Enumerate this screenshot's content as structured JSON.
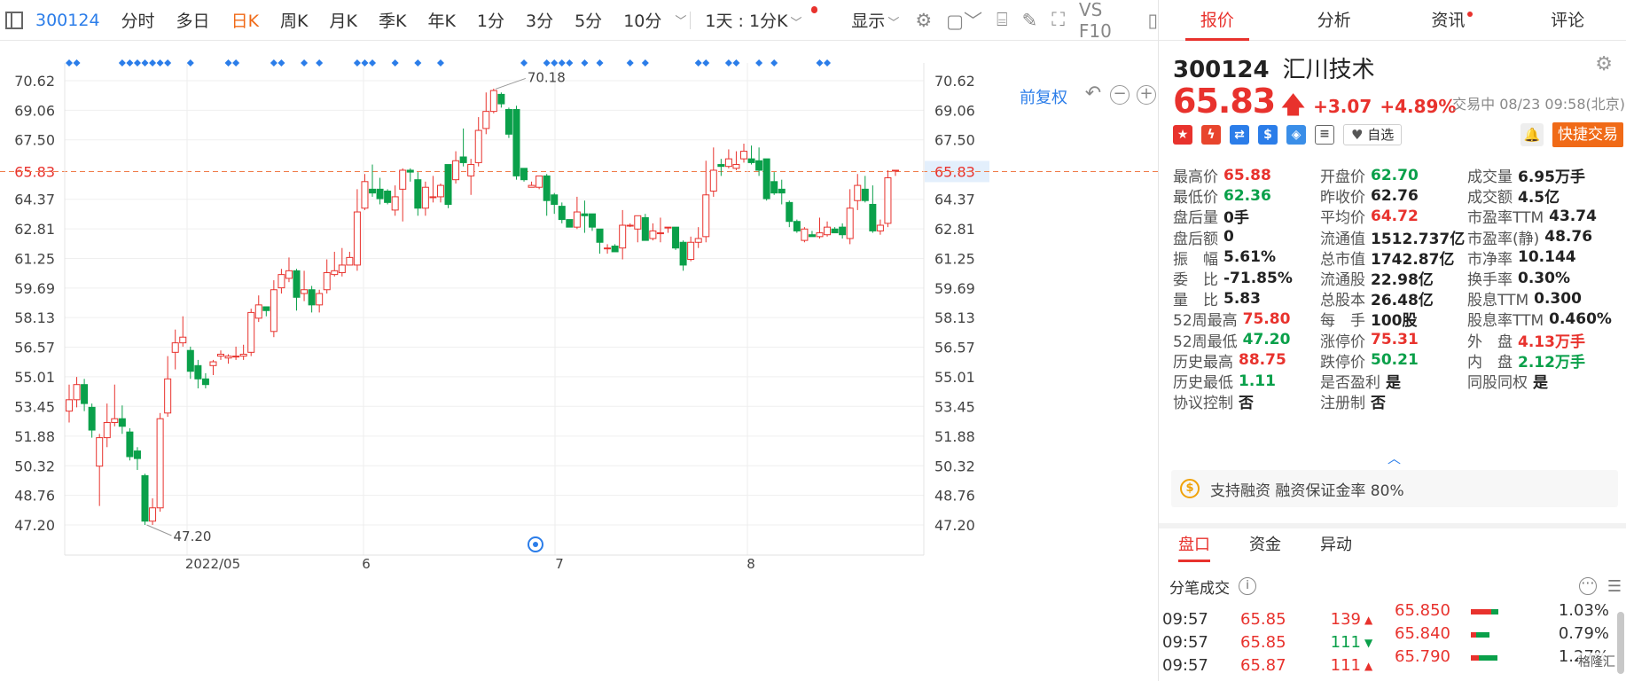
{
  "toolbar": {
    "code": "300124",
    "periods": [
      "分时",
      "多日",
      "日K",
      "周K",
      "月K",
      "季K",
      "年K",
      "1分",
      "3分",
      "5分",
      "10分"
    ],
    "active_period": "日K",
    "interval_select": "1天 : 1分K",
    "display_label": "显示",
    "f10_label": "VS F10"
  },
  "chart": {
    "fq_label": "前复权",
    "y_ticks": [
      "70.62",
      "69.06",
      "67.50",
      "65.83",
      "64.37",
      "62.81",
      "61.25",
      "59.69",
      "58.13",
      "56.57",
      "55.01",
      "53.45",
      "51.88",
      "50.32",
      "48.76",
      "47.20"
    ],
    "current_price_label": "65.83",
    "x_labels": [
      "2022/05",
      "6",
      "7",
      "8"
    ],
    "max_label": "70.18",
    "min_label": "47.20",
    "colors": {
      "up": "#e8322d",
      "down": "#0aa04a",
      "marker": "#2b7de9",
      "price_line": "#f07b4a"
    }
  },
  "chart_data": {
    "type": "candlestick",
    "ylim": [
      47.2,
      70.62
    ],
    "current_price": 65.83,
    "max": 70.18,
    "min": 47.2,
    "candles": [
      [
        53.2,
        53.8,
        54.6,
        52.6
      ],
      [
        53.8,
        54.6,
        55.0,
        53.4
      ],
      [
        54.6,
        53.6,
        54.9,
        53.2
      ],
      [
        53.4,
        52.2,
        53.6,
        51.8
      ],
      [
        50.3,
        51.8,
        52.0,
        48.2
      ],
      [
        51.8,
        52.6,
        53.6,
        51.3
      ],
      [
        52.6,
        52.8,
        54.6,
        52.4
      ],
      [
        52.8,
        52.4,
        53.5,
        52.0
      ],
      [
        52.1,
        50.8,
        52.3,
        50.6
      ],
      [
        51.1,
        50.7,
        51.3,
        50.1
      ],
      [
        49.8,
        47.4,
        49.9,
        47.2
      ],
      [
        47.4,
        48.1,
        48.6,
        47.2
      ],
      [
        48.1,
        52.8,
        53.1,
        47.9
      ],
      [
        53.1,
        54.9,
        56.1,
        52.9
      ],
      [
        56.3,
        56.8,
        57.5,
        55.4
      ],
      [
        56.8,
        57.1,
        58.2,
        56.6
      ],
      [
        56.4,
        55.3,
        56.6,
        54.9
      ],
      [
        55.6,
        54.9,
        55.9,
        54.4
      ],
      [
        54.9,
        54.6,
        55.2,
        54.4
      ],
      [
        55.6,
        55.8,
        55.9,
        55.1
      ],
      [
        56.1,
        56.2,
        56.4,
        55.9
      ],
      [
        56.0,
        56.1,
        56.2,
        55.7
      ],
      [
        56.1,
        56.1,
        56.6,
        55.9
      ],
      [
        56.1,
        56.2,
        56.7,
        55.9
      ],
      [
        56.3,
        58.4,
        58.6,
        56.1
      ],
      [
        58.1,
        58.8,
        59.3,
        57.9
      ],
      [
        58.7,
        58.5,
        58.6,
        58.2
      ],
      [
        57.4,
        59.6,
        60.1,
        57.1
      ],
      [
        59.7,
        60.4,
        60.7,
        59.4
      ],
      [
        60.2,
        60.6,
        61.3,
        60.0
      ],
      [
        60.6,
        59.2,
        60.7,
        58.5
      ],
      [
        59.4,
        59.6,
        60.6,
        59.0
      ],
      [
        59.6,
        58.8,
        59.8,
        58.4
      ],
      [
        58.8,
        59.4,
        59.6,
        58.4
      ],
      [
        59.6,
        60.5,
        61.2,
        59.4
      ],
      [
        60.4,
        60.6,
        61.6,
        60.3
      ],
      [
        60.5,
        60.9,
        61.8,
        60.3
      ],
      [
        60.9,
        61.3,
        61.6,
        60.9
      ],
      [
        60.9,
        63.7,
        64.9,
        60.6
      ],
      [
        63.9,
        65.3,
        65.7,
        63.8
      ],
      [
        64.9,
        64.7,
        66.2,
        64.5
      ],
      [
        64.9,
        64.4,
        65.5,
        64.1
      ],
      [
        64.8,
        64.2,
        64.9,
        64.1
      ],
      [
        63.8,
        64.5,
        65.1,
        63.5
      ],
      [
        64.9,
        65.9,
        66.0,
        63.2
      ],
      [
        65.9,
        65.8,
        66.0,
        65.3
      ],
      [
        65.4,
        63.9,
        65.8,
        63.5
      ],
      [
        63.9,
        65.0,
        65.3,
        63.5
      ],
      [
        64.5,
        64.5,
        65.6,
        64.2
      ],
      [
        64.5,
        65.1,
        65.2,
        64.2
      ],
      [
        66.2,
        64.1,
        66.2,
        63.9
      ],
      [
        65.4,
        66.4,
        66.9,
        65.2
      ],
      [
        66.6,
        66.3,
        68.1,
        66.1
      ],
      [
        65.6,
        66.2,
        66.5,
        64.6
      ],
      [
        66.3,
        68.0,
        68.7,
        66.1
      ],
      [
        68.1,
        69.0,
        70.0,
        67.8
      ],
      [
        69.0,
        70.1,
        70.2,
        68.9
      ],
      [
        69.9,
        69.4,
        70.0,
        69.2
      ],
      [
        69.1,
        67.8,
        69.2,
        67.6
      ],
      [
        69.1,
        65.6,
        69.3,
        65.4
      ],
      [
        66.0,
        65.4,
        65.7,
        65.3
      ],
      [
        65.0,
        65.1,
        65.3,
        65.0
      ],
      [
        65.0,
        65.6,
        65.6,
        64.9
      ],
      [
        65.6,
        64.3,
        65.7,
        63.5
      ],
      [
        64.6,
        64.1,
        64.7,
        63.6
      ],
      [
        64.0,
        63.3,
        64.2,
        63.1
      ],
      [
        63.3,
        62.9,
        63.2,
        62.9
      ],
      [
        62.9,
        63.7,
        64.5,
        62.8
      ],
      [
        63.6,
        63.5,
        64.3,
        62.6
      ],
      [
        63.6,
        62.9,
        63.6,
        62.7
      ],
      [
        62.8,
        62.1,
        62.7,
        61.5
      ],
      [
        61.8,
        61.8,
        62.0,
        61.5
      ],
      [
        61.9,
        61.6,
        62.0,
        61.6
      ],
      [
        61.8,
        63.0,
        63.8,
        61.2
      ],
      [
        63.0,
        63.0,
        63.1,
        62.9
      ],
      [
        62.8,
        63.5,
        63.5,
        62.1
      ],
      [
        63.4,
        62.2,
        63.6,
        62.2
      ],
      [
        62.3,
        62.7,
        63.1,
        62.2
      ],
      [
        62.6,
        62.6,
        63.4,
        62.1
      ],
      [
        62.9,
        62.9,
        62.9,
        62.6
      ],
      [
        62.9,
        61.8,
        62.1,
        61.7
      ],
      [
        62.1,
        60.9,
        62.2,
        60.6
      ],
      [
        61.2,
        62.1,
        62.4,
        61.1
      ],
      [
        62.1,
        62.3,
        62.9,
        61.8
      ],
      [
        62.4,
        64.6,
        66.4,
        62.1
      ],
      [
        64.8,
        65.9,
        67.1,
        64.5
      ],
      [
        66.2,
        66.1,
        66.5,
        65.6
      ],
      [
        66.1,
        66.5,
        67.0,
        66.0
      ],
      [
        66.0,
        66.2,
        66.9,
        65.9
      ],
      [
        66.5,
        66.9,
        67.3,
        66.3
      ],
      [
        66.5,
        66.3,
        67.2,
        66.2
      ],
      [
        66.4,
        65.9,
        67.1,
        65.6
      ],
      [
        66.5,
        64.4,
        66.2,
        64.3
      ],
      [
        65.3,
        64.7,
        65.8,
        64.6
      ],
      [
        64.9,
        64.7,
        65.4,
        64.1
      ],
      [
        64.2,
        63.2,
        64.3,
        62.9
      ],
      [
        63.2,
        62.7,
        63.3,
        62.6
      ],
      [
        62.2,
        62.8,
        62.9,
        62.1
      ],
      [
        62.5,
        62.4,
        62.7,
        62.4
      ],
      [
        62.4,
        62.6,
        63.4,
        62.3
      ],
      [
        62.5,
        62.9,
        63.2,
        62.4
      ],
      [
        62.8,
        62.6,
        62.9,
        62.6
      ],
      [
        62.9,
        62.5,
        63.1,
        62.3
      ],
      [
        62.3,
        63.9,
        64.9,
        62.0
      ],
      [
        64.3,
        65.1,
        65.7,
        63.8
      ],
      [
        64.9,
        64.3,
        65.6,
        64.2
      ],
      [
        64.1,
        62.7,
        65.1,
        62.6
      ],
      [
        62.7,
        63.0,
        63.3,
        62.5
      ],
      [
        63.1,
        65.5,
        65.9,
        62.9
      ],
      [
        65.9,
        65.9,
        65.9,
        65.6
      ]
    ],
    "marker_rows": [
      "◆ ◆",
      "◆ ◆ ◆ ◆ ◆ ◆ ◆",
      "◆ ◆"
    ],
    "x_labels": [
      "2022/05",
      "6",
      "7",
      "8"
    ]
  },
  "quote": {
    "tabs": [
      "报价",
      "分析",
      "资讯",
      "评论"
    ],
    "code": "300124",
    "name": "汇川技术",
    "price": "65.83",
    "change": "+3.07",
    "change_pct": "+4.89%",
    "status": "交易中 08/23 09:58(北京)",
    "watch_label": "自选",
    "quick_trade_label": "快捷交易",
    "col1": [
      {
        "k": "最高价",
        "v": "65.88",
        "c": "red"
      },
      {
        "k": "最低价",
        "v": "62.36",
        "c": "green"
      },
      {
        "k": "盘后量",
        "v": "0手",
        "c": ""
      },
      {
        "k": "盘后额",
        "v": "0",
        "c": ""
      },
      {
        "k": "振　幅",
        "v": "5.61%",
        "c": ""
      },
      {
        "k": "委　比",
        "v": "-71.85%",
        "c": ""
      },
      {
        "k": "量　比",
        "v": "5.83",
        "c": ""
      },
      {
        "k": "52周最高",
        "v": "75.80",
        "c": "red"
      },
      {
        "k": "52周最低",
        "v": "47.20",
        "c": "green"
      },
      {
        "k": "历史最高",
        "v": "88.75",
        "c": "red"
      },
      {
        "k": "历史最低",
        "v": "1.11",
        "c": "green"
      },
      {
        "k": "协议控制",
        "v": "否",
        "c": ""
      }
    ],
    "col2": [
      {
        "k": "开盘价",
        "v": "62.70",
        "c": "green"
      },
      {
        "k": "昨收价",
        "v": "62.76",
        "c": ""
      },
      {
        "k": "平均价",
        "v": "64.72",
        "c": "red"
      },
      {
        "k": "流通值",
        "v": "1512.737亿",
        "c": ""
      },
      {
        "k": "总市值",
        "v": "1742.87亿",
        "c": ""
      },
      {
        "k": "流通股",
        "v": "22.98亿",
        "c": ""
      },
      {
        "k": "总股本",
        "v": "26.48亿",
        "c": ""
      },
      {
        "k": "每　手",
        "v": "100股",
        "c": ""
      },
      {
        "k": "涨停价",
        "v": "75.31",
        "c": "red"
      },
      {
        "k": "跌停价",
        "v": "50.21",
        "c": "green"
      },
      {
        "k": "是否盈利",
        "v": "是",
        "c": ""
      },
      {
        "k": "注册制",
        "v": "否",
        "c": ""
      }
    ],
    "col3": [
      {
        "k": "成交量",
        "v": "6.95万手",
        "c": ""
      },
      {
        "k": "成交额",
        "v": "4.5亿",
        "c": ""
      },
      {
        "k": "市盈率TTM",
        "v": "43.74",
        "c": ""
      },
      {
        "k": "市盈率(静)",
        "v": "48.76",
        "c": ""
      },
      {
        "k": "市净率",
        "v": "10.144",
        "c": ""
      },
      {
        "k": "换手率",
        "v": "0.30%",
        "c": ""
      },
      {
        "k": "股息TTM",
        "v": "0.300",
        "c": ""
      },
      {
        "k": "股息率TTM",
        "v": "0.460%",
        "c": ""
      },
      {
        "k": "外　盘",
        "v": "4.13万手",
        "c": "red"
      },
      {
        "k": "内　盘",
        "v": "2.12万手",
        "c": "green"
      },
      {
        "k": "同股同权",
        "v": "是",
        "c": ""
      }
    ],
    "margin_text": "支持融资 融资保证金率 80%",
    "sub_tabs": [
      "盘口",
      "资金",
      "异动"
    ],
    "tick_title": "分笔成交",
    "ticks": [
      {
        "time": "09:57",
        "price": "65.85",
        "vol": "139",
        "dir": "up"
      },
      {
        "time": "09:57",
        "price": "65.85",
        "vol": "111",
        "dir": "down"
      },
      {
        "time": "09:57",
        "price": "65.87",
        "vol": "111",
        "dir": "up"
      }
    ],
    "levels": [
      {
        "price": "65.850",
        "pct": "1.03%",
        "red": 0.75,
        "green": 0.25
      },
      {
        "price": "65.840",
        "pct": "0.79%",
        "red": 0.2,
        "green": 0.5
      },
      {
        "price": "65.790",
        "pct": "1.27%",
        "red": 0.3,
        "green": 0.7
      }
    ],
    "watermark": "格隆汇"
  }
}
